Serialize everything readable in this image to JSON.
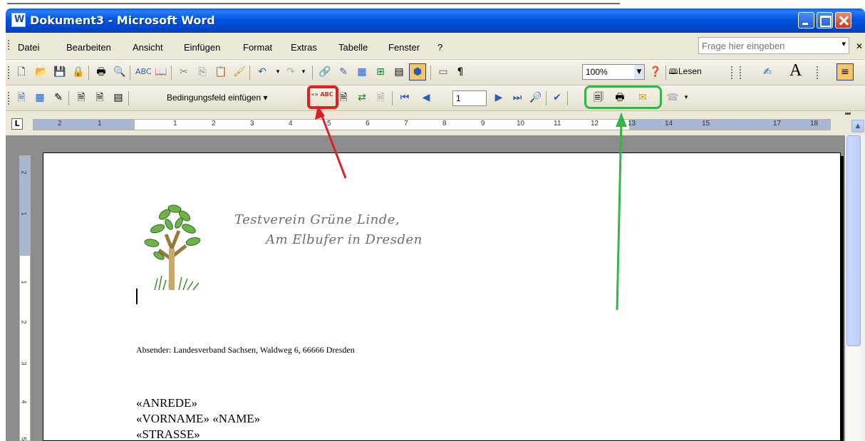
{
  "window": {
    "title": "Dokument3 - Microsoft Word"
  },
  "menu": {
    "items": [
      "Datei",
      "Bearbeiten",
      "Ansicht",
      "Einfügen",
      "Format",
      "Extras",
      "Tabelle",
      "Fenster",
      "?"
    ],
    "help_placeholder": "Frage hier eingeben"
  },
  "toolbar": {
    "zoom": "100%",
    "lesen_label": "Lesen",
    "big_a": "A",
    "pilcrow": "¶"
  },
  "mailmerge": {
    "insert_field_label": "Bedingungsfeld einfügen ▾",
    "merge_fields_icon_text": "«» ABC",
    "record_number": "1"
  },
  "ruler": {
    "marks": [
      "2",
      "1",
      "1",
      "2",
      "3",
      "4",
      "5",
      "6",
      "7",
      "8",
      "9",
      "10",
      "11",
      "12",
      "13",
      "14",
      "15",
      "17",
      "18"
    ],
    "vertical_marks": [
      "2",
      "1",
      "1",
      "2",
      "3",
      "4",
      "5"
    ]
  },
  "document": {
    "letterhead_line1": "Testverein Grüne Linde,",
    "letterhead_line2": "Am Elbufer in Dresden",
    "sender": "Absender: Landesverband Sachsen, Waldweg 6, 66666 Dresden",
    "fields": [
      "«ANREDE»",
      "«VORNAME» «NAME»",
      "«STRASSE»"
    ]
  },
  "colors": {
    "highlight_red": "#e02020",
    "highlight_green": "#35b548",
    "titlebar": "#0054e3"
  }
}
